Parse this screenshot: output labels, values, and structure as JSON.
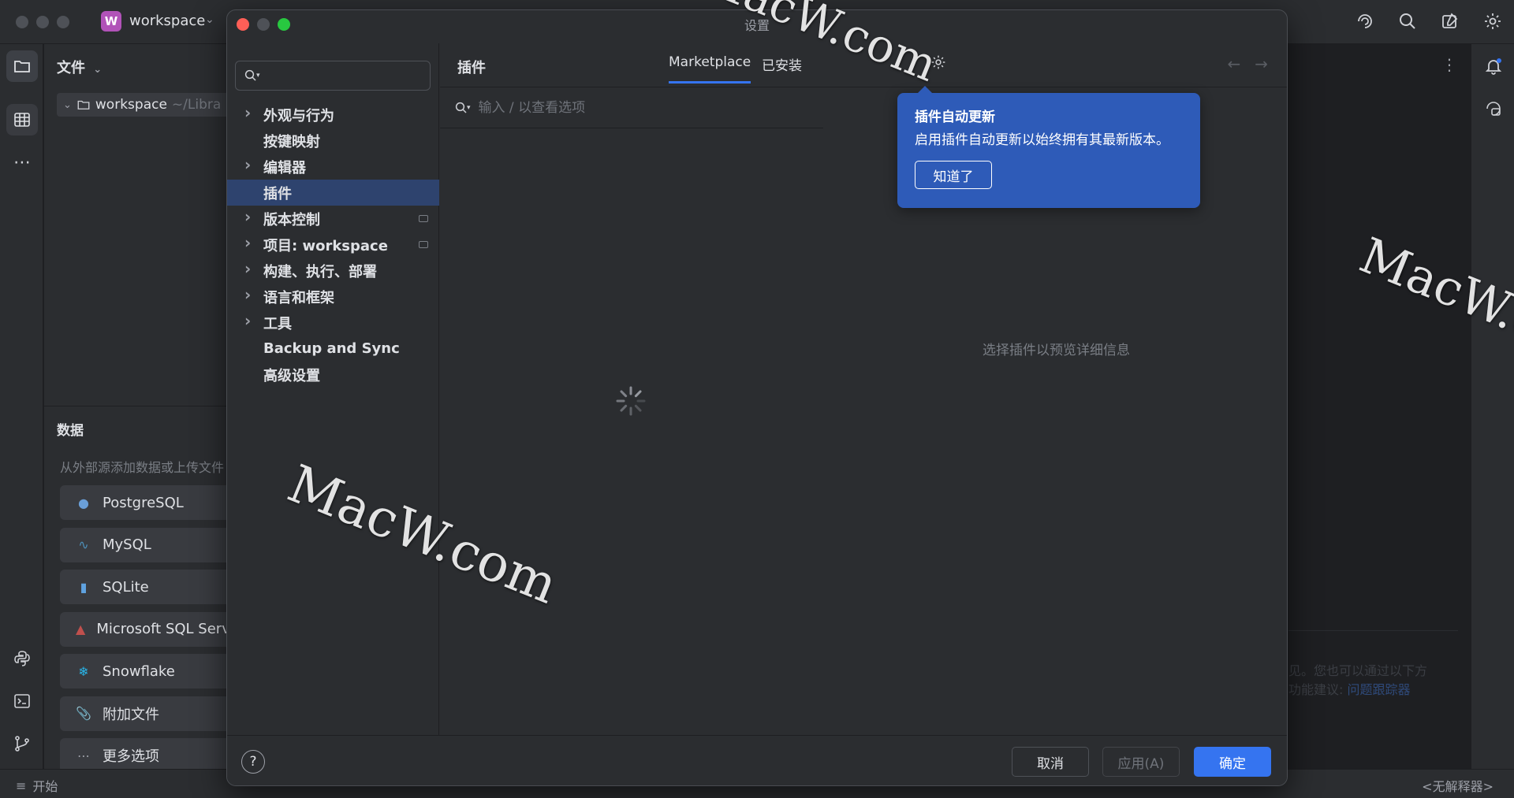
{
  "ide": {
    "workspace_badge": "W",
    "workspace_name": "workspace",
    "project_panel_title": "文件",
    "project_root": "workspace",
    "project_root_path": "~/Libra",
    "data_title": "数据",
    "data_desc": "从外部源添加数据或上传文件",
    "data_sources": [
      {
        "label": "PostgreSQL",
        "icon": "postgresql-icon",
        "color": "#6a9fd8"
      },
      {
        "label": "MySQL",
        "icon": "mysql-icon",
        "color": "#4d8fb8"
      },
      {
        "label": "SQLite",
        "icon": "sqlite-icon",
        "color": "#5fa2e0"
      },
      {
        "label": "Microsoft SQL Server",
        "icon": "mssql-icon",
        "color": "#c0504d"
      },
      {
        "label": "Snowflake",
        "icon": "snowflake-icon",
        "color": "#29b5e8"
      },
      {
        "label": "附加文件",
        "icon": "paperclip-icon",
        "color": "#9da0a8"
      },
      {
        "label": "更多选项",
        "icon": "more-icon",
        "color": "#9da0a8"
      }
    ],
    "bg_hint_line1": "见。您也可以通过以下方",
    "bg_hint_line2": "功能建议:",
    "bg_hint_link": "问题跟踪器",
    "status_left": "开始",
    "status_right": "<无解释器>"
  },
  "dialog": {
    "title": "设置",
    "search_value": "",
    "nav": [
      {
        "label": "外观与行为",
        "expandable": true,
        "badge": false,
        "selected": false
      },
      {
        "label": "按键映射",
        "expandable": false,
        "badge": false,
        "selected": false
      },
      {
        "label": "编辑器",
        "expandable": true,
        "badge": false,
        "selected": false
      },
      {
        "label": "插件",
        "expandable": false,
        "badge": false,
        "selected": true
      },
      {
        "label": "版本控制",
        "expandable": true,
        "badge": true,
        "selected": false
      },
      {
        "label": "项目: workspace",
        "expandable": true,
        "badge": true,
        "selected": false
      },
      {
        "label": "构建、执行、部署",
        "expandable": true,
        "badge": false,
        "selected": false
      },
      {
        "label": "语言和框架",
        "expandable": true,
        "badge": false,
        "selected": false
      },
      {
        "label": "工具",
        "expandable": true,
        "badge": false,
        "selected": false
      },
      {
        "label": "Backup and Sync",
        "expandable": false,
        "badge": false,
        "selected": false
      },
      {
        "label": "高级设置",
        "expandable": false,
        "badge": false,
        "selected": false
      }
    ],
    "page_title": "插件",
    "tabs": [
      {
        "label": "Marketplace",
        "active": true
      },
      {
        "label": "已安装",
        "active": false
      }
    ],
    "plugin_search_placeholder": "输入 / 以查看选项",
    "detail_placeholder": "选择插件以预览详细信息",
    "tooltip": {
      "title": "插件自动更新",
      "body": "启用插件自动更新以始终拥有其最新版本。",
      "button": "知道了"
    },
    "help_label": "?",
    "cancel_label": "取消",
    "apply_label": "应用(A)",
    "ok_label": "确定"
  },
  "watermark": "MacW.com",
  "colors": {
    "accent": "#3574f0",
    "tooltip_bg": "#2e5bb8",
    "selection": "#2e436e",
    "close": "#ff5f57",
    "minimize": "#4e5157",
    "maximize": "#28c840"
  }
}
